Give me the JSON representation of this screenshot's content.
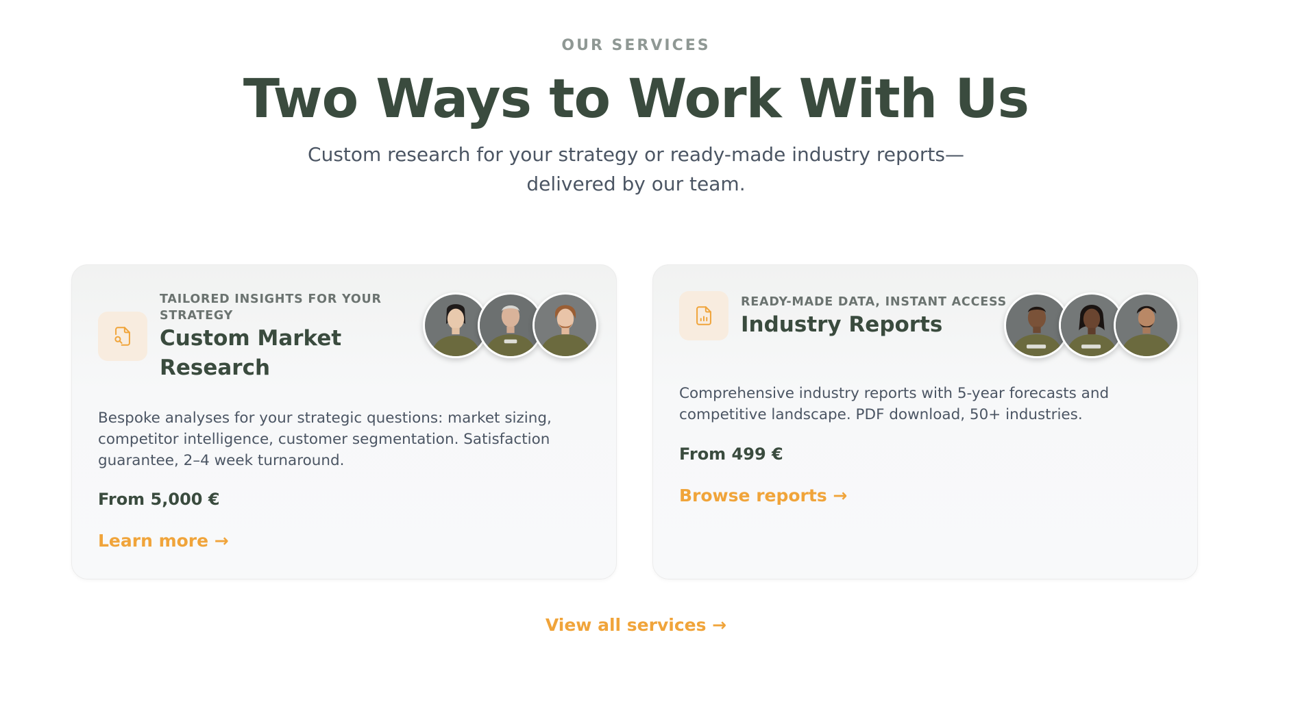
{
  "section": {
    "eyebrow": "OUR SERVICES",
    "title": "Two Ways to Work With Us",
    "subtitle_line1": "Custom research for your strategy or ready-made industry reports—",
    "subtitle_line2": "delivered by our team."
  },
  "cards": [
    {
      "icon": "document-search-icon",
      "kicker": "TAILORED INSIGHTS FOR YOUR STRATEGY",
      "title": "Custom Market Research",
      "description": "Bespoke analyses for your strategic questions: market sizing, competitor intelligence, customer segmentation. Satisfaction guarantee, 2–4 week turnaround.",
      "price": "From 5,000 €",
      "cta": "Learn more →"
    },
    {
      "icon": "document-chart-icon",
      "kicker": "READY-MADE DATA, INSTANT ACCESS",
      "title": "Industry Reports",
      "description": "Comprehensive industry reports with 5-year forecasts and competitive landscape. PDF download, 50+ industries.",
      "price": "From 499 €",
      "cta": "Browse reports →"
    }
  ],
  "footer_link": "View all services →",
  "colors": {
    "accent": "#f0a43a",
    "heading": "#3a4b3e",
    "icon_bg": "#f8ecdf",
    "hoodie": "#6b6a3e"
  }
}
